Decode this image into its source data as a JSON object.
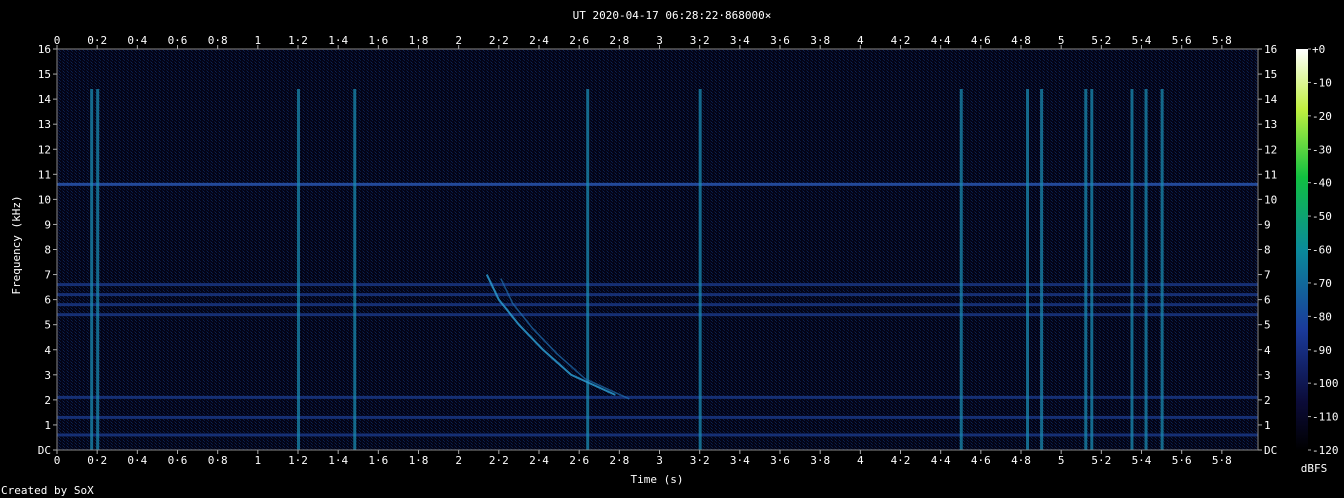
{
  "chart_data": {
    "type": "heatmap",
    "title": "UT 2020-04-17 06:28:22·868000×",
    "xlabel": "Time (s)",
    "ylabel": "Frequency (kHz)",
    "xlim": [
      0,
      5.98
    ],
    "ylim": [
      0,
      16
    ],
    "x_ticks": [
      "0",
      "0·2",
      "0·4",
      "0·6",
      "0·8",
      "1",
      "1·2",
      "1·4",
      "1·6",
      "1·8",
      "2",
      "2·2",
      "2·4",
      "2·6",
      "2·8",
      "3",
      "3·2",
      "3·4",
      "3·6",
      "3·8",
      "4",
      "4·2",
      "4·4",
      "4·6",
      "4·8",
      "5",
      "5·2",
      "5·4",
      "5·6",
      "5·8"
    ],
    "y_ticks": [
      "DC",
      "1",
      "2",
      "3",
      "4",
      "5",
      "6",
      "7",
      "8",
      "9",
      "10",
      "11",
      "12",
      "13",
      "14",
      "15",
      "16"
    ],
    "colorbar": {
      "label": "dBFS",
      "ticks": [
        "+0",
        "-10",
        "-20",
        "-30",
        "-40",
        "-50",
        "-60",
        "-70",
        "-80",
        "-90",
        "-100",
        "-110",
        "-120"
      ],
      "range": [
        -120,
        0
      ]
    },
    "features": {
      "horizontal_bands_khz": [
        0.6,
        1.3,
        2.1,
        5.4,
        5.8,
        6.2,
        6.6,
        10.6
      ],
      "vertical_impulses_s": [
        0.17,
        0.2,
        1.2,
        1.48,
        2.64,
        3.2,
        4.5,
        4.83,
        4.9,
        5.12,
        5.15,
        5.35,
        5.42,
        5.5
      ],
      "whistler": [
        {
          "t": 2.14,
          "f": 7.0
        },
        {
          "t": 2.2,
          "f": 6.0
        },
        {
          "t": 2.3,
          "f": 5.0
        },
        {
          "t": 2.42,
          "f": 4.0
        },
        {
          "t": 2.56,
          "f": 3.0
        },
        {
          "t": 2.78,
          "f": 2.2
        }
      ]
    }
  },
  "footer": {
    "credit": "Created by SoX"
  },
  "colors": {
    "background": "#000000",
    "text": "#ffffff",
    "colormap_low": "#000000",
    "colormap_mid": "#1e4aa0",
    "colormap_high": "#ffffff"
  }
}
